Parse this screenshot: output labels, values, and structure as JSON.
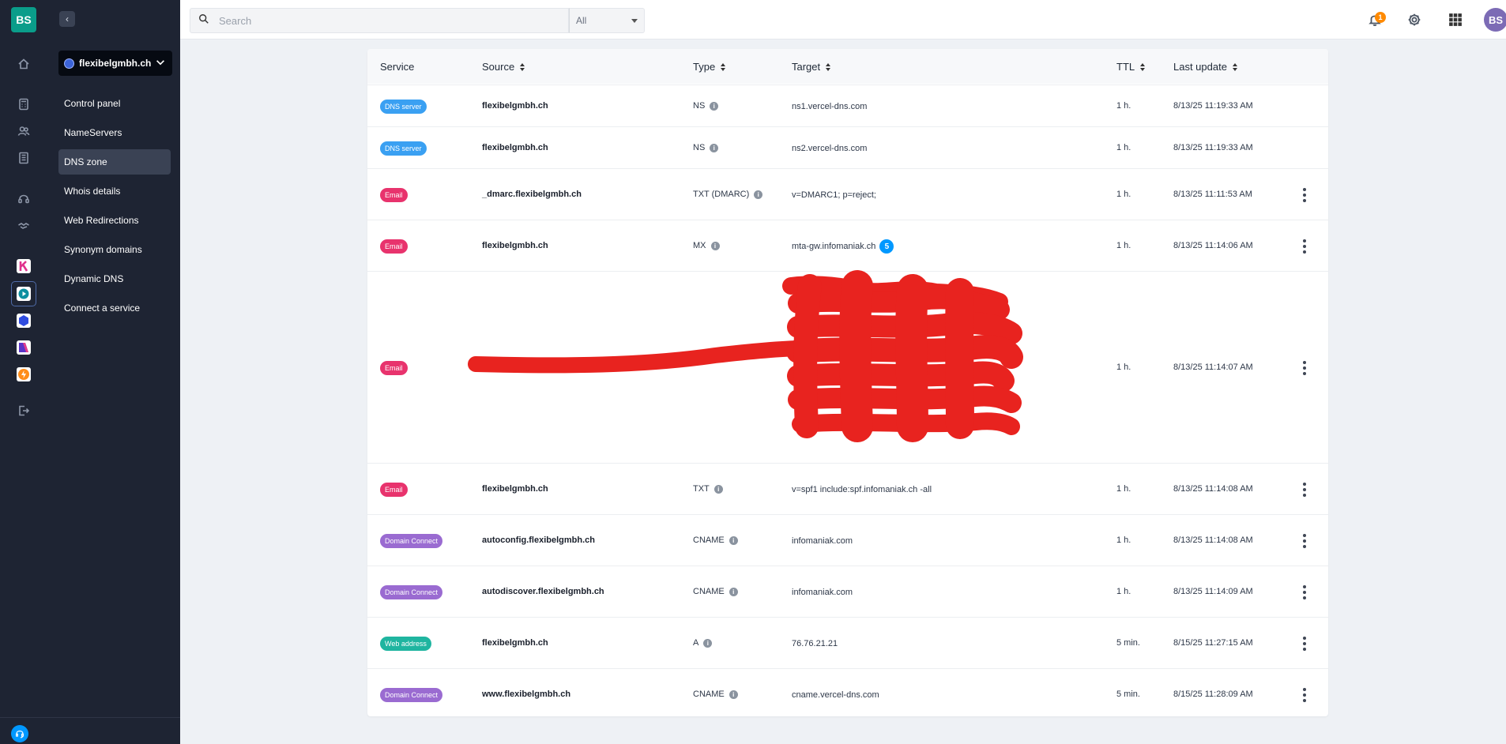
{
  "rail": {
    "logo": "BS"
  },
  "sidebar": {
    "domain": "flexibelgmbh.ch",
    "items": [
      {
        "label": "Control panel"
      },
      {
        "label": "NameServers"
      },
      {
        "label": "DNS zone"
      },
      {
        "label": "Whois details"
      },
      {
        "label": "Web Redirections"
      },
      {
        "label": "Synonym domains"
      },
      {
        "label": "Dynamic DNS"
      },
      {
        "label": "Connect a service"
      }
    ]
  },
  "topbar": {
    "search_placeholder": "Search",
    "filter_value": "All",
    "notification_count": "1",
    "avatar": "BS"
  },
  "table": {
    "headers": {
      "service": "Service",
      "source": "Source",
      "type": "Type",
      "target": "Target",
      "ttl": "TTL",
      "last_update": "Last update"
    },
    "rows": [
      {
        "service": "DNS server",
        "service_color": "#3aa0f2",
        "source": "flexibelgmbh.ch",
        "type": "NS",
        "target": "ns1.vercel-dns.com",
        "ttl": "1 h.",
        "updated": "8/13/25 11:19:33 AM"
      },
      {
        "service": "DNS server",
        "service_color": "#3aa0f2",
        "source": "flexibelgmbh.ch",
        "type": "NS",
        "target": "ns2.vercel-dns.com",
        "ttl": "1 h.",
        "updated": "8/13/25 11:19:33 AM"
      },
      {
        "service": "Email",
        "service_color": "#e8336d",
        "source": "_dmarc.flexibelgmbh.ch",
        "type": "TXT (DMARC)",
        "target": "v=DMARC1; p=reject;",
        "ttl": "1 h.",
        "updated": "8/13/25 11:11:53 AM"
      },
      {
        "service": "Email",
        "service_color": "#e8336d",
        "source": "flexibelgmbh.ch",
        "type": "MX",
        "target": "mta-gw.infomaniak.ch",
        "target_count": "5",
        "ttl": "1 h.",
        "updated": "8/13/25 11:14:06 AM"
      },
      {
        "service": "Email",
        "service_color": "#e8336d",
        "source": "",
        "type": "",
        "target": "",
        "ttl": "1 h.",
        "updated": "8/13/25 11:14:07 AM"
      },
      {
        "service": "Email",
        "service_color": "#e8336d",
        "source": "flexibelgmbh.ch",
        "type": "TXT",
        "target": "v=spf1 include:spf.infomaniak.ch -all",
        "ttl": "1 h.",
        "updated": "8/13/25 11:14:08 AM"
      },
      {
        "service": "Domain Connect",
        "service_color": "#9a6bd1",
        "source": "autoconfig.flexibelgmbh.ch",
        "type": "CNAME",
        "target": "infomaniak.com",
        "ttl": "1 h.",
        "updated": "8/13/25 11:14:08 AM"
      },
      {
        "service": "Domain Connect",
        "service_color": "#9a6bd1",
        "source": "autodiscover.flexibelgmbh.ch",
        "type": "CNAME",
        "target": "infomaniak.com",
        "ttl": "1 h.",
        "updated": "8/13/25 11:14:09 AM"
      },
      {
        "service": "Web address",
        "service_color": "#1fb5a0",
        "source": "flexibelgmbh.ch",
        "type": "A",
        "target": "76.76.21.21",
        "ttl": "5 min.",
        "updated": "8/15/25 11:27:15 AM"
      },
      {
        "service": "Domain Connect",
        "service_color": "#9a6bd1",
        "source": "www.flexibelgmbh.ch",
        "type": "CNAME",
        "target": "cname.vercel-dns.com",
        "ttl": "5 min.",
        "updated": "8/15/25 11:28:09 AM"
      }
    ]
  },
  "icons": [
    "home-icon",
    "calculator-icon",
    "users-icon",
    "building-icon",
    "headset-icon",
    "handshake-icon",
    "logout-icon",
    "search-icon",
    "bell-icon",
    "gear-icon",
    "apps-grid-icon",
    "info-icon",
    "more-vert-icon",
    "sort-icon"
  ],
  "colors": {
    "sidebar_bg": "#1e2433",
    "accent": "#0098ff",
    "brand": "#0a9d8a",
    "redaction": "#e8231f"
  }
}
